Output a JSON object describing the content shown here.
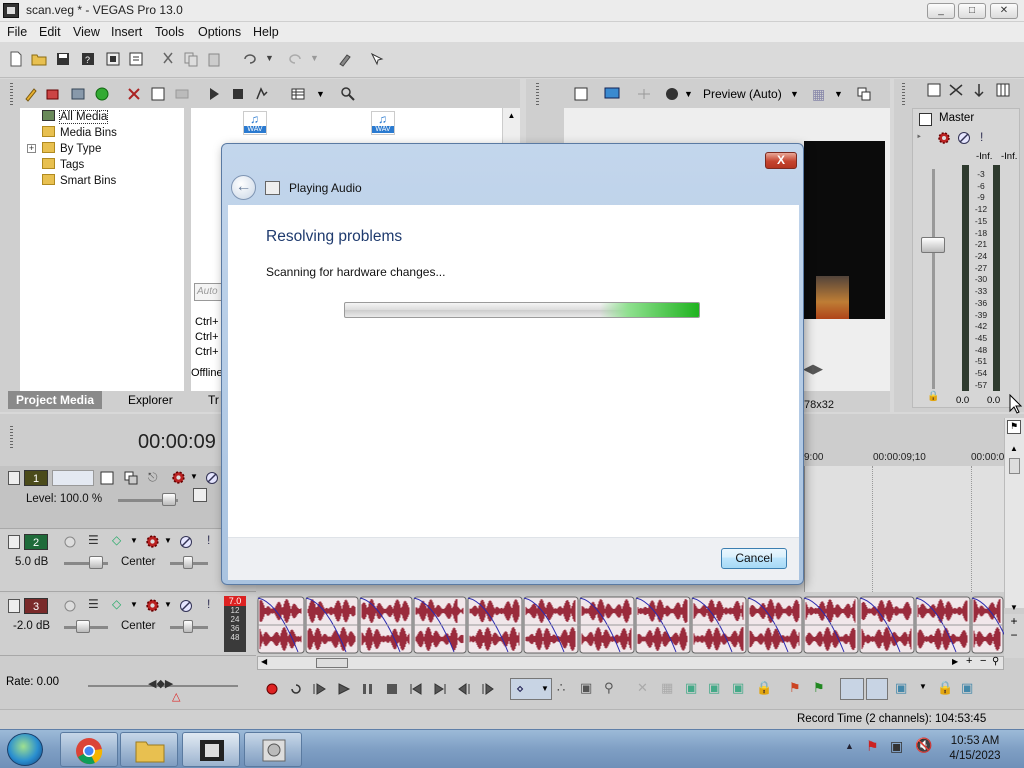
{
  "window": {
    "title": "scan.veg * - VEGAS Pro 13.0"
  },
  "menu": [
    "File",
    "Edit",
    "View",
    "Insert",
    "Tools",
    "Options",
    "Help"
  ],
  "media_tree": {
    "items": [
      "All Media",
      "Media Bins",
      "By Type",
      "Tags",
      "Smart Bins"
    ],
    "expand_glyph": "+",
    "tabs": {
      "project_media": "Project Media",
      "explorer": "Explorer",
      "transitions": "Tr"
    }
  },
  "media_files": {
    "badge1": "WAV",
    "badge2": "WAV",
    "search_placeholder": "Auto",
    "shortcut1": "Ctrl+",
    "shortcut2": "Ctrl+",
    "shortcut3": "Ctrl+",
    "offline": "Offline"
  },
  "preview": {
    "mode_label": "Preview (Auto)",
    "size_suffix": "78x32"
  },
  "master": {
    "label": "Master",
    "inf_left": "-Inf.",
    "inf_right": "-Inf.",
    "scale": [
      "3",
      "6",
      "9",
      "12",
      "15",
      "18",
      "21",
      "24",
      "27",
      "30",
      "33",
      "36",
      "39",
      "42",
      "45",
      "48",
      "51",
      "54",
      "57"
    ],
    "val_left": "0.0",
    "val_right": "0.0"
  },
  "timeline": {
    "timecode": "00:00:09",
    "ruler": [
      "9:00",
      "00:00:09;10",
      "00:00:0"
    ],
    "tracks": [
      {
        "num": "1",
        "level_label": "Level: 100.0 %"
      },
      {
        "num": "2",
        "db": "5.0 dB",
        "pan": "Center"
      },
      {
        "num": "3",
        "db": "-2.0 dB",
        "pan": "Center",
        "meter_peak": "7.0",
        "meter_scale": [
          "12",
          "24",
          "36",
          "48"
        ]
      }
    ],
    "rate": "Rate: 0.00",
    "record_time": "Record Time (2 channels): 104:53:45"
  },
  "dialog": {
    "header_title": "Playing Audio",
    "heading": "Resolving problems",
    "status": "Scanning for hardware changes...",
    "progress_fraction": 0.2,
    "cancel_label": "Cancel",
    "close_glyph": "X"
  },
  "taskbar": {
    "time": "10:53 AM",
    "date": "4/15/2023"
  },
  "colors": {
    "progress_green": "#1fb31f",
    "track1": "#4b4b1a",
    "track2": "#1f6b3a",
    "track3": "#7a2a2a",
    "waveform": "#9a2b3c"
  }
}
